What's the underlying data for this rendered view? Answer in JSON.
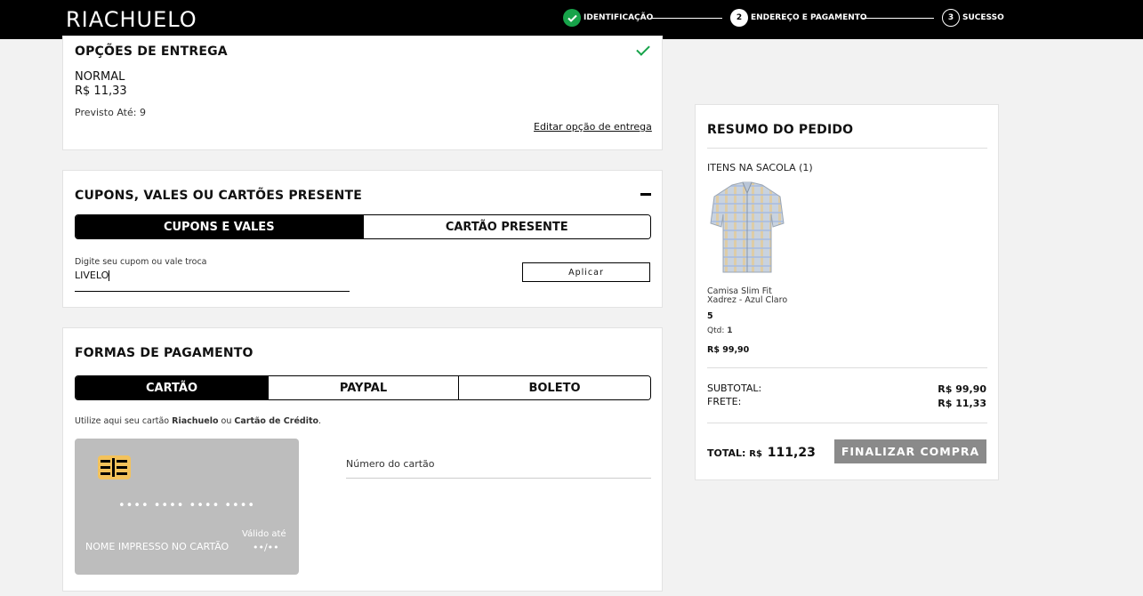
{
  "header": {
    "logo": "RIACHUELO",
    "steps": [
      {
        "number": "",
        "label": "IDENTIFICAÇÃO",
        "state": "done"
      },
      {
        "number": "2",
        "label": "ENDEREÇO E PAGAMENTO",
        "state": "current"
      },
      {
        "number": "3",
        "label": "SUCESSO",
        "state": "next"
      }
    ]
  },
  "delivery": {
    "title": "OPÇÕES DE ENTREGA",
    "option_name": "NORMAL",
    "price": "R$ 11,33",
    "estimate": "Previsto Até: 9",
    "edit_link": "Editar opção de entrega"
  },
  "coupons": {
    "title": "CUPONS, VALES OU CARTÕES PRESENTE",
    "collapse_symbol": "−",
    "tabs": [
      "CUPONS E VALES",
      "CARTÃO PRESENTE"
    ],
    "field_label": "Digite seu cupom ou vale troca",
    "field_value": "LIVELO",
    "apply_button": "Aplicar"
  },
  "payment": {
    "title": "FORMAS DE PAGAMENTO",
    "tabs": [
      "CARTÃO",
      "PAYPAL",
      "BOLETO"
    ],
    "info_prefix": "Utilize aqui seu cartão ",
    "info_bold1": "Riachuelo",
    "info_mid": " ou ",
    "info_bold2": "Cartão de Crédito",
    "info_suffix": ".",
    "card_number_mask": "•••• •••• •••• ••••",
    "card_name": "NOME IMPRESSO NO CARTÃO",
    "valid_label": "Válido até",
    "valid_mask": "••/••",
    "card_number_placeholder": "Número do cartão"
  },
  "summary": {
    "title": "RESUMO DO PEDIDO",
    "items_label": "ITENS NA SACOLA (1)",
    "item": {
      "name_line1": "Camisa Slim Fit",
      "name_line2": "Xadrez - Azul Claro",
      "size": "5",
      "qty_label": "Qtd:",
      "qty_value": "1",
      "price": "R$ 99,90"
    },
    "subtotal_label": "SUBTOTAL:",
    "subtotal_value": "R$ 99,90",
    "shipping_label": "FRETE:",
    "shipping_value": "R$ 11,33",
    "total_label": "TOTAL:",
    "total_currency": "R$",
    "total_value": "111,23",
    "checkout_button": "FINALIZAR COMPRA"
  },
  "colors": {
    "success": "#17a34a",
    "chip": "#f3c25b",
    "card_bg": "#bdbdbd",
    "checkout_bg": "#8a8a8a"
  }
}
